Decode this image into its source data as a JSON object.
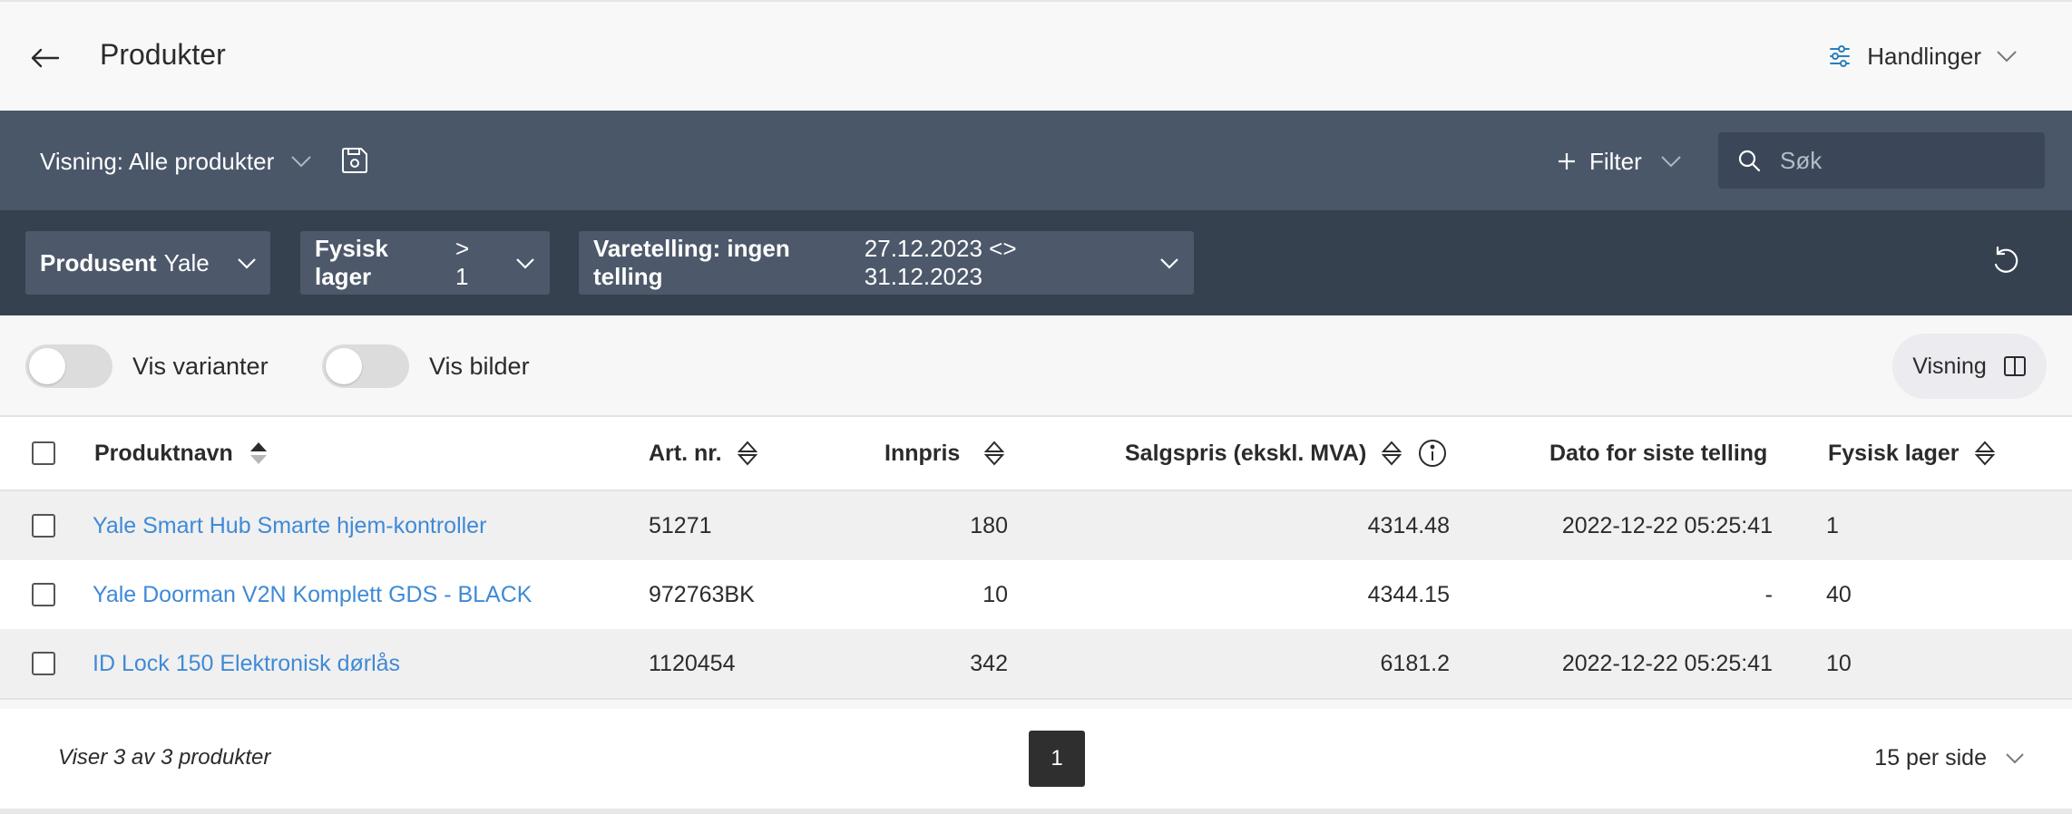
{
  "header": {
    "title": "Produkter",
    "actions_label": "Handlinger"
  },
  "toolbar": {
    "view_label": "Visning: Alle produkter",
    "filter_label": "Filter",
    "search_placeholder": "Søk"
  },
  "filters": [
    {
      "key": "Produsent",
      "value": "Yale"
    },
    {
      "key": "Fysisk lager",
      "value": "> 1"
    },
    {
      "key": "Varetelling: ingen telling",
      "value": "27.12.2023 <> 31.12.2023"
    }
  ],
  "toggles": {
    "variants_label": "Vis varianter",
    "images_label": "Vis bilder",
    "visning_label": "Visning"
  },
  "table": {
    "columns": {
      "name": "Produktnavn",
      "art_nr": "Art. nr.",
      "innpris": "Innpris",
      "salgspris": "Salgspris (ekskl. MVA)",
      "dato": "Dato for siste telling",
      "lager": "Fysisk lager"
    },
    "rows": [
      {
        "name": "Yale Smart Hub Smarte hjem-kontroller",
        "art_nr": "51271",
        "innpris": "180",
        "salgspris": "4314.48",
        "dato": "2022-12-22 05:25:41",
        "lager": "1"
      },
      {
        "name": "Yale Doorman V2N Komplett GDS - BLACK",
        "art_nr": "972763BK",
        "innpris": "10",
        "salgspris": "4344.15",
        "dato": "-",
        "lager": "40"
      },
      {
        "name": "ID Lock 150 Elektronisk dørlås",
        "art_nr": "1120454",
        "innpris": "342",
        "salgspris": "6181.2",
        "dato": "2022-12-22 05:25:41",
        "lager": "10"
      }
    ]
  },
  "footer": {
    "count_text": "Viser 3 av 3 produkter",
    "current_page": "1",
    "per_page": "15 per side"
  }
}
